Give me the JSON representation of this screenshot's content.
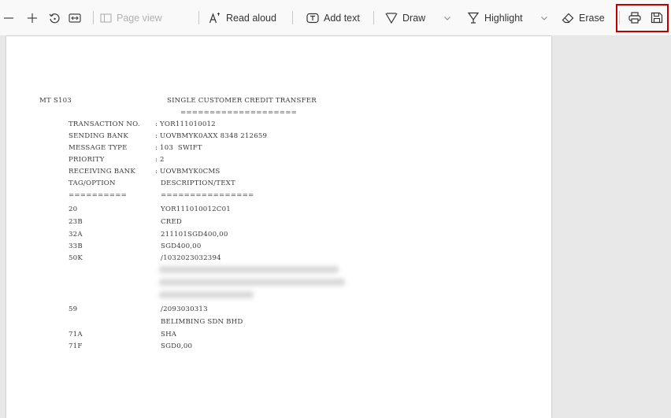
{
  "toolbar": {
    "page_view": "Page view",
    "read_aloud": "Read aloud",
    "add_text": "Add text",
    "draw": "Draw",
    "highlight": "Highlight",
    "erase": "Erase"
  },
  "document": {
    "mt_code": "MT S103",
    "heading": "SINGLE CUSTOMER CREDIT TRANSFER",
    "heading_rule": "====================",
    "header_fields": [
      {
        "label": "TRANSACTION NO.",
        "value": ": YOR111010012"
      },
      {
        "label": "SENDING BANK",
        "value": ": UOVBMYK0AXX 8348 212659"
      },
      {
        "label": "MESSAGE TYPE",
        "value": ": 103  SWIFT"
      },
      {
        "label": "PRIORITY",
        "value": ": 2"
      },
      {
        "label": "RECEIVING BANK",
        "value": ": UOVBMYK0CMS"
      }
    ],
    "col_tag": "TAG/OPTION",
    "col_desc": "DESCRIPTION/TEXT",
    "col_tag_rule": "==========",
    "col_desc_rule": "================",
    "rows": [
      {
        "tag": "20",
        "text": "YOR111010012C01"
      },
      {
        "tag": "23B",
        "text": "CRED"
      },
      {
        "tag": "32A",
        "text": "211101SGD400,00"
      },
      {
        "tag": "33B",
        "text": "SGD400,00"
      },
      {
        "tag": "50K",
        "text": "/1032023032394"
      },
      {
        "tag": "59",
        "text": "/2093030313"
      },
      {
        "tag": "",
        "text": "BELIMBING SDN BHD"
      },
      {
        "tag": "71A",
        "text": "SHA"
      },
      {
        "tag": "71F",
        "text": "SGD0,00"
      }
    ]
  }
}
